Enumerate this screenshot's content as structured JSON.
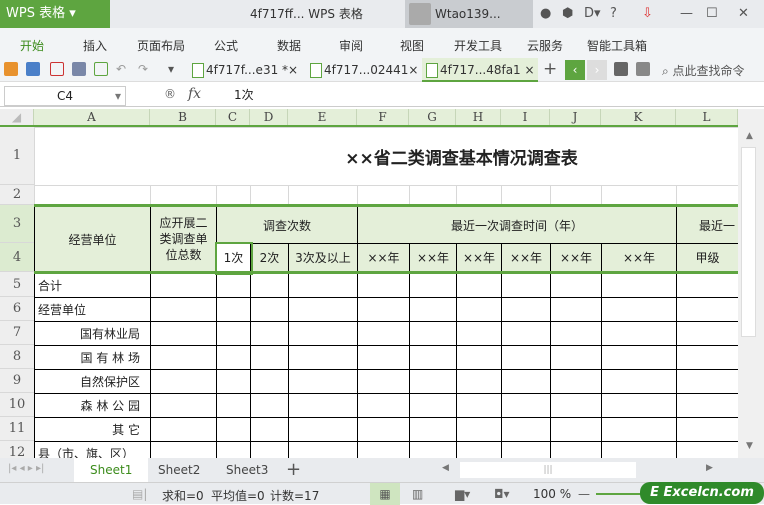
{
  "titlebar": {
    "app": "WPS 表格",
    "doc_title": "4f717ff... WPS 表格",
    "user": "Wtao139...",
    "help": "?"
  },
  "menu": [
    "开始",
    "插入",
    "页面布局",
    "公式",
    "数据",
    "审阅",
    "视图",
    "开发工具",
    "云服务",
    "智能工具箱"
  ],
  "doc_tabs": [
    {
      "label": "4f717f...e31 *×"
    },
    {
      "label": "4f717...02441×"
    },
    {
      "label": "4f717...48fa1 ×"
    }
  ],
  "toolbar": {
    "search": "点此查找命令",
    "new_tab": "+"
  },
  "formula_bar": {
    "cell_ref": "C4",
    "fx": "fx",
    "value": "1次"
  },
  "columns": [
    "A",
    "B",
    "C",
    "D",
    "E",
    "F",
    "G",
    "H",
    "I",
    "J",
    "K",
    "L"
  ],
  "rows": [
    "1",
    "2",
    "3",
    "4",
    "5",
    "6",
    "7",
    "8",
    "9",
    "10",
    "11",
    "12"
  ],
  "sheet": {
    "title": "××省二类调查基本情况调查表",
    "h_unit": "经营单位",
    "h_total": "应开展二类调查单位总数",
    "h_count": "调查次数",
    "h_recent": "最近一次调查时间（年）",
    "h_recent2": "最近一",
    "sub": [
      "1次",
      "2次",
      "3次及以上",
      "××年",
      "××年",
      "××年",
      "××年",
      "××年",
      "××年",
      "甲级"
    ],
    "body": [
      "合计",
      "经营单位",
      "国有林业局",
      "国 有  林 场",
      "自然保护区",
      "森 林  公 园",
      "其        它",
      "县（市、旗、区）"
    ]
  },
  "sheet_tabs": [
    "Sheet1",
    "Sheet2",
    "Sheet3"
  ],
  "add_sheet": "+",
  "status": {
    "sum": "求和=0",
    "avg": "平均值=0",
    "count": "计数=17",
    "zoom": "100 %"
  },
  "watermark": "Excelcn.com",
  "colors": {
    "accent": "#5ea540",
    "header_fill": "#e4efd9"
  }
}
